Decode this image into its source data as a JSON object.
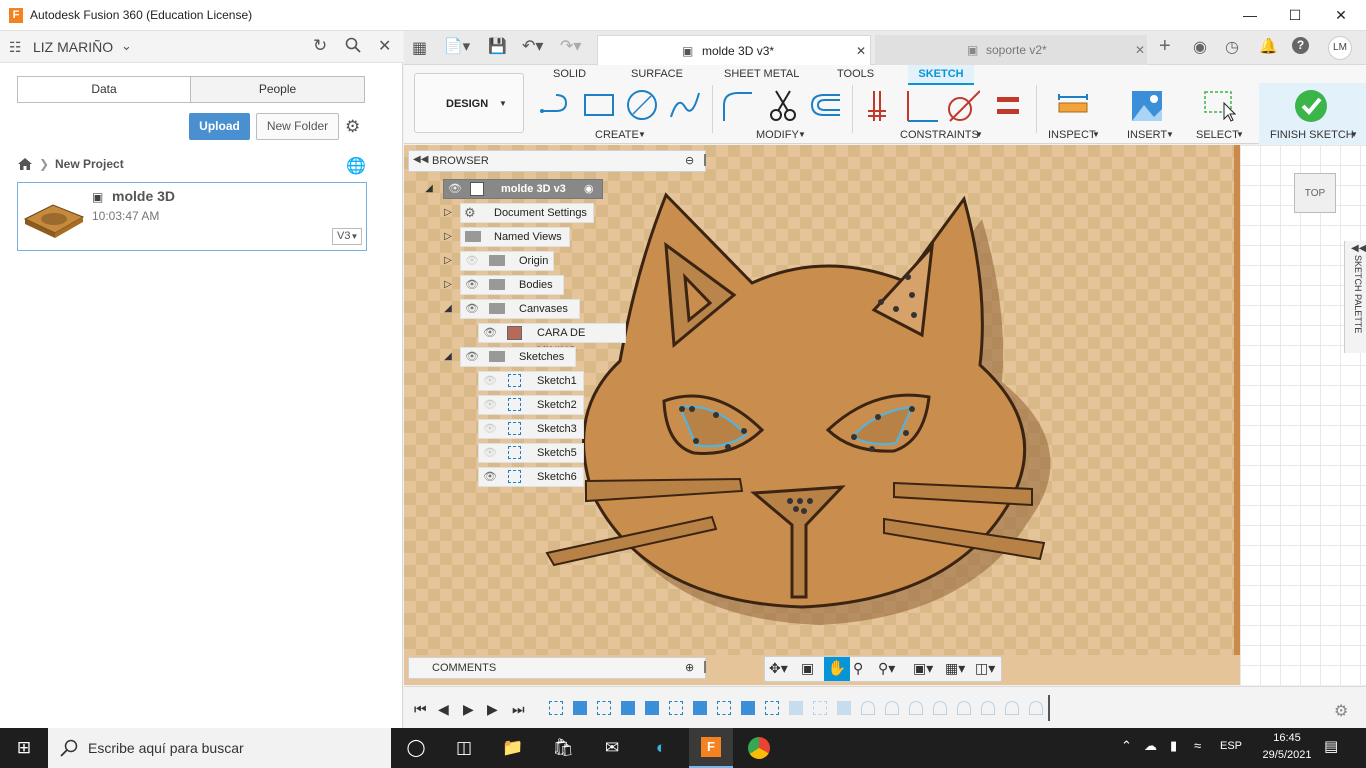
{
  "window": {
    "title": "Autodesk Fusion 360 (Education License)",
    "app_icon": "F"
  },
  "left_panel": {
    "user_name": "LIZ MARIÑO",
    "tabs": [
      "Data",
      "People"
    ],
    "upload_label": "Upload",
    "new_folder_label": "New Folder",
    "breadcrumb_project": "New Project",
    "file": {
      "name": "molde 3D",
      "time": "10:03:47 AM",
      "version": "V3"
    }
  },
  "doc_tabs": [
    {
      "label": "molde 3D v3*",
      "active": true
    },
    {
      "label": "soporte v2*",
      "active": false
    }
  ],
  "user_initials": "LM",
  "toolbar": {
    "workspace": "DESIGN",
    "workspace_tabs": [
      "SOLID",
      "SURFACE",
      "SHEET METAL",
      "TOOLS",
      "SKETCH"
    ],
    "groups": [
      "CREATE",
      "MODIFY",
      "CONSTRAINTS",
      "INSPECT",
      "INSERT",
      "SELECT",
      "FINISH SKETCH"
    ]
  },
  "browser": {
    "title": "BROWSER",
    "root": "molde 3D v3",
    "items": [
      {
        "label": "Document Settings"
      },
      {
        "label": "Named Views"
      },
      {
        "label": "Origin"
      },
      {
        "label": "Bodies"
      },
      {
        "label": "Canvases"
      },
      {
        "label": "CARA DE MININO"
      },
      {
        "label": "Sketches"
      },
      {
        "label": "Sketch1"
      },
      {
        "label": "Sketch2"
      },
      {
        "label": "Sketch3"
      },
      {
        "label": "Sketch5"
      },
      {
        "label": "Sketch6"
      }
    ]
  },
  "comments_label": "COMMENTS",
  "viewcube_label": "TOP",
  "sketch_palette_label": "SKETCH PALETTE",
  "taskbar": {
    "search_placeholder": "Escribe aquí para buscar",
    "language": "ESP",
    "time": "16:45",
    "date": "29/5/2021"
  },
  "colors": {
    "accent": "#0696d7",
    "upload": "#4a90d1",
    "finish": "#3bb54a"
  }
}
